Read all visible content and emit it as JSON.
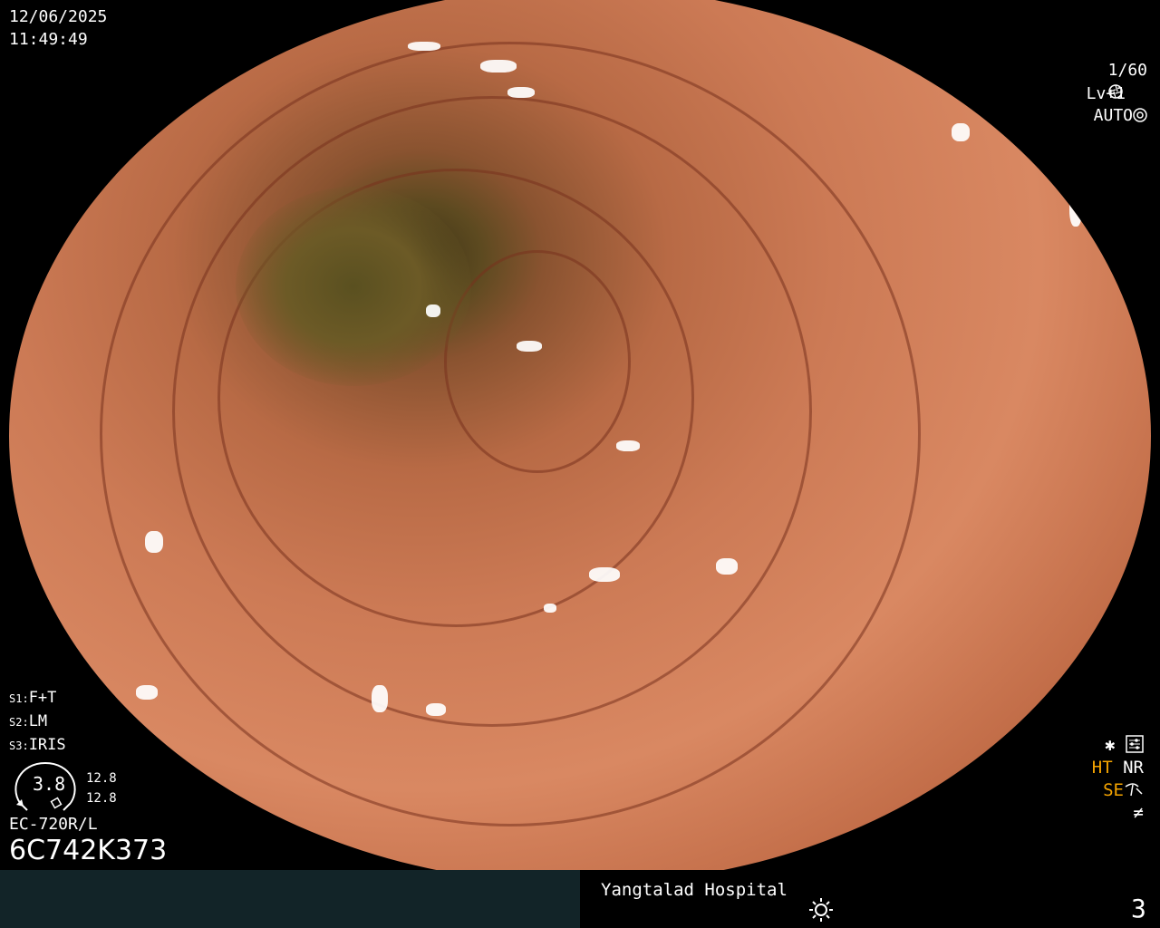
{
  "overlay": {
    "date": "12/06/2025",
    "time": "11:49:49",
    "shutter": "1/60",
    "shutter_icon": "aperture-icon",
    "level": "Lv+1",
    "auto_label": "AUTO",
    "auto_icon": "camera-iris-icon"
  },
  "settings": {
    "s1_prefix": "S1:",
    "s1_value": "F+T",
    "s2_prefix": "S2:",
    "s2_value": "LM",
    "s3_prefix": "S3:",
    "s3_value": "IRIS"
  },
  "gauge": {
    "value": "3.8",
    "zoom_top": "12.8",
    "zoom_bottom": "12.8"
  },
  "scope": {
    "model": "EC-720R/L",
    "serial": "6C742K373"
  },
  "status": {
    "star_icon": "asterisk-icon",
    "settings_icon": "sliders-icon",
    "ht": "HT",
    "nr": "NR",
    "se": "SE",
    "se_icon": "fan-icon",
    "freeze_icon": "not-equal-icon",
    "ht_color": "#f5a400",
    "se_color": "#f5a400"
  },
  "footer": {
    "hospital": "Yangtalad Hospital",
    "brightness_icon": "sun-icon",
    "page": "3"
  }
}
